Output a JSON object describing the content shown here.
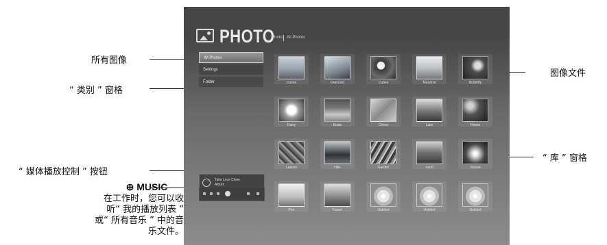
{
  "callouts": {
    "all_images": "所有图像",
    "category_pane": "“ 类别 ” 窗格",
    "image_file": "图像文件",
    "library_pane": "“ 库 ” 窗格",
    "media_control": "“ 媒体播放控制 ” 按钮",
    "music_key": "⊕ MUSIC",
    "music_note": "在工作时，您可以收听“ 我的播放列表 ” 或“ 所有音乐 ” 中的音乐文件。"
  },
  "screen": {
    "app_title": "PHOTO",
    "breadcrumb": [
      "Photo",
      "All Photos"
    ],
    "category_items": [
      {
        "label": "All Photos",
        "selected": true
      },
      {
        "label": "Settings",
        "selected": false
      },
      {
        "label": "Folder",
        "selected": false
      }
    ],
    "media_control": {
      "line1": "Take Love Close",
      "line2": "Album"
    },
    "library": [
      {
        "label": "Canon",
        "texture": "t-a"
      },
      {
        "label": "Overcast",
        "texture": "t-b"
      },
      {
        "label": "Cubes",
        "texture": "t-c"
      },
      {
        "label": "Meadow",
        "texture": "t-d"
      },
      {
        "label": "Butterfly",
        "texture": "t-e"
      },
      {
        "label": "Daisy",
        "texture": "t-f"
      },
      {
        "label": "Boats",
        "texture": "t-g"
      },
      {
        "label": "Chess",
        "texture": "t-h"
      },
      {
        "label": "Lake",
        "texture": "t-i"
      },
      {
        "label": "Flower",
        "texture": "t-j"
      },
      {
        "label": "Leaves",
        "texture": "t-k"
      },
      {
        "label": "Hills",
        "texture": "t-l"
      },
      {
        "label": "Garden",
        "texture": "t-m"
      },
      {
        "label": "Sand",
        "texture": "t-n"
      },
      {
        "label": "Sunset",
        "texture": "t-o"
      },
      {
        "label": "Pier",
        "texture": "t-p"
      },
      {
        "label": "Forest",
        "texture": "t-q"
      },
      {
        "label": "Untitled",
        "texture": "t-disc"
      },
      {
        "label": "Untitled",
        "texture": "t-disc"
      },
      {
        "label": "Untitled",
        "texture": "t-disc"
      }
    ]
  }
}
